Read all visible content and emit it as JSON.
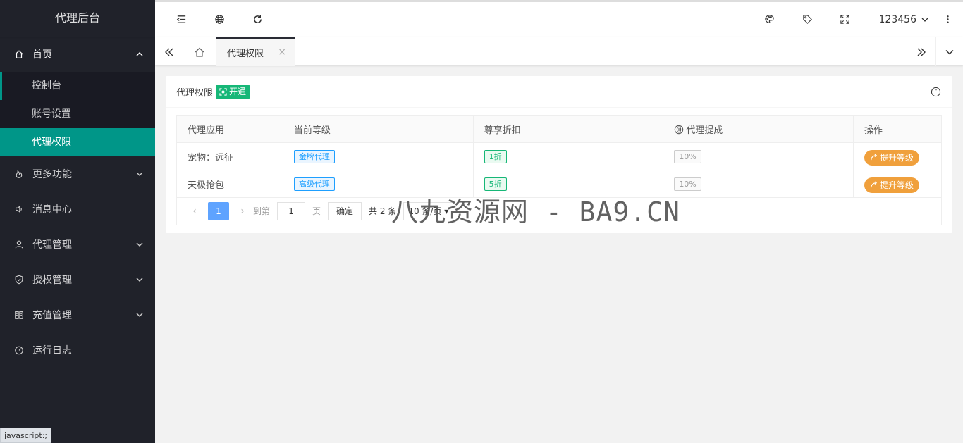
{
  "sidebar": {
    "logo": "代理后台",
    "home": "首页",
    "sub_items": [
      "控制台",
      "账号设置",
      "代理权限"
    ],
    "items": [
      {
        "label": "更多功能",
        "icon": "fire-icon",
        "has_arrow": true
      },
      {
        "label": "消息中心",
        "icon": "speaker-icon",
        "has_arrow": false
      },
      {
        "label": "代理管理",
        "icon": "user-icon",
        "has_arrow": true
      },
      {
        "label": "授权管理",
        "icon": "shield-check-icon",
        "has_arrow": true
      },
      {
        "label": "充值管理",
        "icon": "book-icon",
        "has_arrow": true
      },
      {
        "label": "运行日志",
        "icon": "dashboard-icon",
        "has_arrow": false
      }
    ],
    "status_tip": "javascript:;"
  },
  "header": {
    "username": "123456"
  },
  "tabs": {
    "active_tab": "代理权限",
    "close": "×"
  },
  "card": {
    "title": "代理权限",
    "badge": "开通",
    "columns": [
      "代理应用",
      "当前等级",
      "尊享折扣",
      "代理提成",
      "操作"
    ],
    "rows": [
      {
        "app": "宠物：远征",
        "level": "金牌代理",
        "discount": "1折",
        "commission": "10%",
        "action": "提升等级"
      },
      {
        "app": "天极抢包",
        "level": "高级代理",
        "discount": "5折",
        "commission": "10%",
        "action": "提升等级"
      }
    ]
  },
  "pager": {
    "prev": "‹",
    "current": "1",
    "next": "›",
    "goto_label": "到第",
    "goto_value": "1",
    "page_label": "页",
    "confirm": "确定",
    "total": "共 2 条",
    "page_size": "10 条/页"
  },
  "watermark": "八九资源网 - BA9.CN",
  "colors": {
    "sidebar_bg": "#20222a",
    "accent": "#009688",
    "badge_green": "#16b777",
    "pager_blue": "#5ea3ff",
    "action_orange": "#f0a03c"
  }
}
